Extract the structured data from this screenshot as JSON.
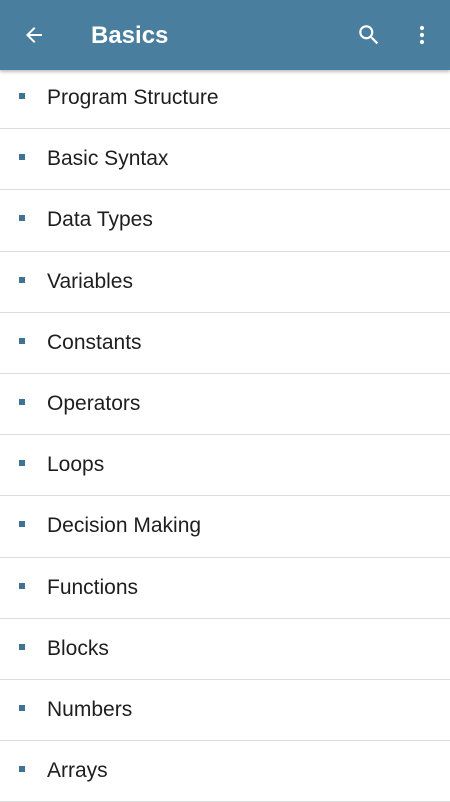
{
  "appbar": {
    "title": "Basics",
    "back_icon": "arrow-left-icon",
    "search_icon": "search-icon",
    "menu_icon": "more-vertical-icon",
    "background_color": "#4a7e9e"
  },
  "list": {
    "bullet_color": "#3f7393",
    "items": [
      {
        "label": "Program Structure"
      },
      {
        "label": "Basic Syntax"
      },
      {
        "label": "Data Types"
      },
      {
        "label": "Variables"
      },
      {
        "label": "Constants"
      },
      {
        "label": "Operators"
      },
      {
        "label": "Loops"
      },
      {
        "label": "Decision Making"
      },
      {
        "label": "Functions"
      },
      {
        "label": "Blocks"
      },
      {
        "label": "Numbers"
      },
      {
        "label": "Arrays"
      }
    ]
  }
}
